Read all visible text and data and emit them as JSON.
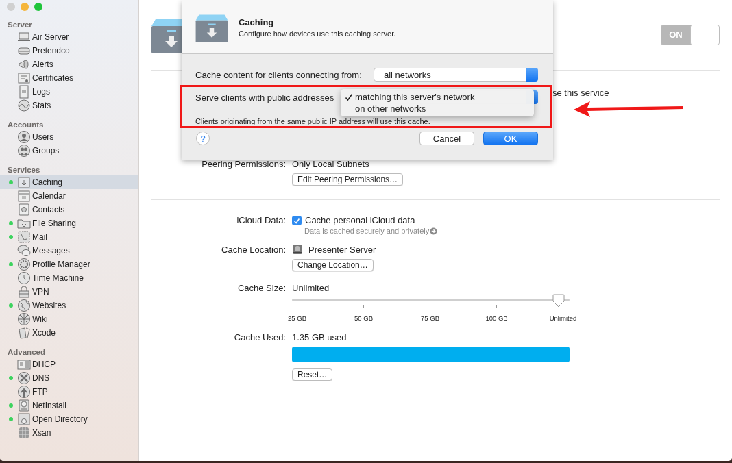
{
  "sidebar": {
    "sections": [
      {
        "title": "Server",
        "items": [
          {
            "label": "Air Server",
            "selected": false,
            "running": false
          },
          {
            "label": "Pretendco",
            "selected": false,
            "running": false
          },
          {
            "label": "Alerts",
            "selected": false,
            "running": false
          },
          {
            "label": "Certificates",
            "selected": false,
            "running": false
          },
          {
            "label": "Logs",
            "selected": false,
            "running": false
          },
          {
            "label": "Stats",
            "selected": false,
            "running": false
          }
        ]
      },
      {
        "title": "Accounts",
        "items": [
          {
            "label": "Users",
            "selected": false,
            "running": false
          },
          {
            "label": "Groups",
            "selected": false,
            "running": false
          }
        ]
      },
      {
        "title": "Services",
        "items": [
          {
            "label": "Caching",
            "selected": true,
            "running": true
          },
          {
            "label": "Calendar",
            "selected": false,
            "running": false
          },
          {
            "label": "Contacts",
            "selected": false,
            "running": false
          },
          {
            "label": "File Sharing",
            "selected": false,
            "running": true
          },
          {
            "label": "Mail",
            "selected": false,
            "running": true
          },
          {
            "label": "Messages",
            "selected": false,
            "running": false
          },
          {
            "label": "Profile Manager",
            "selected": false,
            "running": true
          },
          {
            "label": "Time Machine",
            "selected": false,
            "running": false
          },
          {
            "label": "VPN",
            "selected": false,
            "running": false
          },
          {
            "label": "Websites",
            "selected": false,
            "running": true
          },
          {
            "label": "Wiki",
            "selected": false,
            "running": false
          },
          {
            "label": "Xcode",
            "selected": false,
            "running": false
          }
        ]
      },
      {
        "title": "Advanced",
        "items": [
          {
            "label": "DHCP",
            "selected": false,
            "running": false
          },
          {
            "label": "DNS",
            "selected": false,
            "running": true
          },
          {
            "label": "FTP",
            "selected": false,
            "running": false
          },
          {
            "label": "NetInstall",
            "selected": false,
            "running": true
          },
          {
            "label": "Open Directory",
            "selected": false,
            "running": true
          },
          {
            "label": "Xsan",
            "selected": false,
            "running": false
          }
        ]
      }
    ]
  },
  "service": {
    "toggle_label": "ON",
    "on": true
  },
  "access_note": "se this service",
  "peering": {
    "label": "Peering Permissions:",
    "value": "Only Local Subnets",
    "button": "Edit Peering Permissions…"
  },
  "icloud": {
    "label": "iCloud Data:",
    "checkbox_label": "Cache personal iCloud data",
    "checked": true,
    "note": "Data is cached securely and privately"
  },
  "location": {
    "label": "Cache Location:",
    "value": "Presenter Server",
    "button": "Change Location…"
  },
  "size": {
    "label": "Cache Size:",
    "value": "Unlimited",
    "level": 1,
    "ticks": [
      "25 GB",
      "50 GB",
      "75 GB",
      "100 GB",
      "Unlimited"
    ]
  },
  "used": {
    "label": "Cache Used:",
    "value": "1.35 GB used",
    "level": 1,
    "button": "Reset…"
  },
  "sheet": {
    "title": "Caching",
    "subtitle": "Configure how devices use this caching server.",
    "fields": [
      {
        "label": "Cache content for clients connecting from:",
        "value": "all networks"
      },
      {
        "label": "Serve clients with public addresses"
      }
    ],
    "menu": [
      {
        "label": "matching this server's network",
        "selected": true
      },
      {
        "label": "on other networks",
        "selected": false
      }
    ],
    "note": "Clients originating from the same public IP address will use this cache.",
    "help": "?",
    "buttons": [
      "Cancel",
      "OK"
    ]
  }
}
